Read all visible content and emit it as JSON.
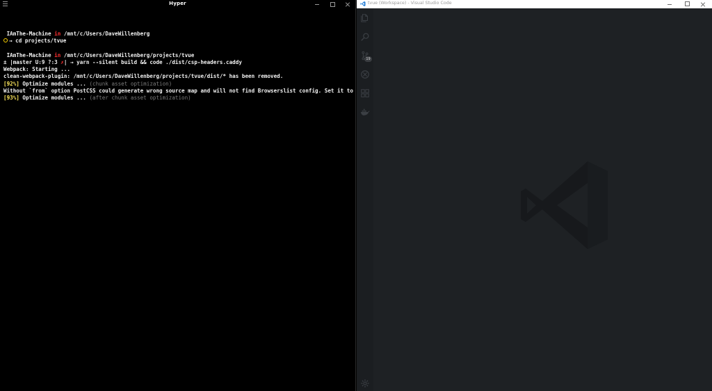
{
  "hyper": {
    "title": "Hyper",
    "lines": [
      [],
      [
        {
          "t": " IAmThe-Machine ",
          "c": "t-white"
        },
        {
          "t": "in",
          "c": "t-red"
        },
        {
          "t": " /mnt/c/Users/DaveWillenberg",
          "c": "t-white"
        }
      ],
      [
        {
          "circle": true
        },
        {
          "t": "→ cd projects/tvue",
          "c": "t-white"
        }
      ],
      [],
      [
        {
          "t": " IAmThe-Machine ",
          "c": "t-white"
        },
        {
          "t": "in",
          "c": "t-red"
        },
        {
          "t": " /mnt/c/Users/DaveWillenberg/projects/tvue",
          "c": "t-white"
        }
      ],
      [
        {
          "t": "± |master U:9 ?:3 ",
          "c": "t-white"
        },
        {
          "t": "✗",
          "c": "t-red"
        },
        {
          "t": "| → yarn --silent build && code ./dist/csp-headers.caddy",
          "c": "t-white"
        }
      ],
      [
        {
          "t": "Webpack: Starting ...",
          "c": "t-white"
        }
      ],
      [
        {
          "t": "clean-webpack-plugin: /mnt/c/Users/DaveWillenberg/projects/tvue/dist/* has been removed.",
          "c": "t-white"
        }
      ],
      [
        {
          "t": "[92%]",
          "c": "t-yellow"
        },
        {
          "t": " Optimize modules ... ",
          "c": "t-white"
        },
        {
          "t": "(chunk asset optimization)",
          "c": "t-gray"
        }
      ],
      [
        {
          "t": "Without `from` option PostCSS could generate wrong source map and will not find Browserslist config. Set it to CS",
          "c": "t-white"
        }
      ],
      [
        {
          "t": "[93%]",
          "c": "t-yellow"
        },
        {
          "t": " Optimize modules ... ",
          "c": "t-white"
        },
        {
          "t": "(after chunk asset optimization)",
          "c": "t-gray"
        }
      ]
    ]
  },
  "vscode": {
    "title": "tvue (Workspace) - Visual Studio Code",
    "activity": [
      {
        "name": "explorer-icon"
      },
      {
        "name": "search-icon"
      },
      {
        "name": "source-control-icon",
        "badge": "19"
      },
      {
        "name": "debug-icon"
      },
      {
        "name": "extensions-icon"
      },
      {
        "name": "docker-icon"
      }
    ],
    "bottom_activity": [
      {
        "name": "settings-gear-icon"
      }
    ]
  },
  "colors": {
    "terminal_bg": "#000000",
    "vscode_bg": "#1e2124",
    "prompt_in": "#ff3030",
    "progress": "#ffe85c"
  }
}
